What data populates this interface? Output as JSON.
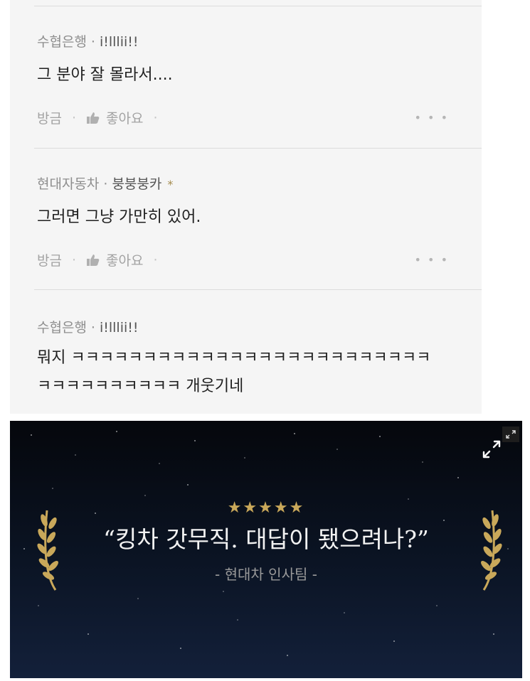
{
  "comments": [
    {
      "bank": "수협은행",
      "nickname": "i!lllii!!",
      "text": "그 분야 잘 몰라서....",
      "time": "방금",
      "like_label": "좋아요",
      "more": "• • •"
    },
    {
      "bank": "현대자동차",
      "nickname": "붕붕붕카",
      "badge": "*",
      "text": "그러면 그냥 가만히 있어.",
      "time": "방금",
      "like_label": "좋아요",
      "more": "• • •"
    },
    {
      "bank": "수협은행",
      "nickname": "i!lllii!!",
      "text": "뭐지 ㅋㅋㅋㅋㅋㅋㅋㅋㅋㅋㅋㅋㅋㅋㅋㅋㅋㅋㅋㅋㅋㅋㅋㅋㅋ\nㅋㅋㅋㅋㅋㅋㅋㅋㅋㅋ 개웃기네"
    }
  ],
  "separator": "·",
  "banner": {
    "rating": "★★★★★",
    "quote": "“킹차 갓무직. 대답이 됐으려나?”",
    "credit": "- 현대차 인사팀 -",
    "expand_icon": "expand-icon",
    "laurel_color": "#c9a85a"
  }
}
